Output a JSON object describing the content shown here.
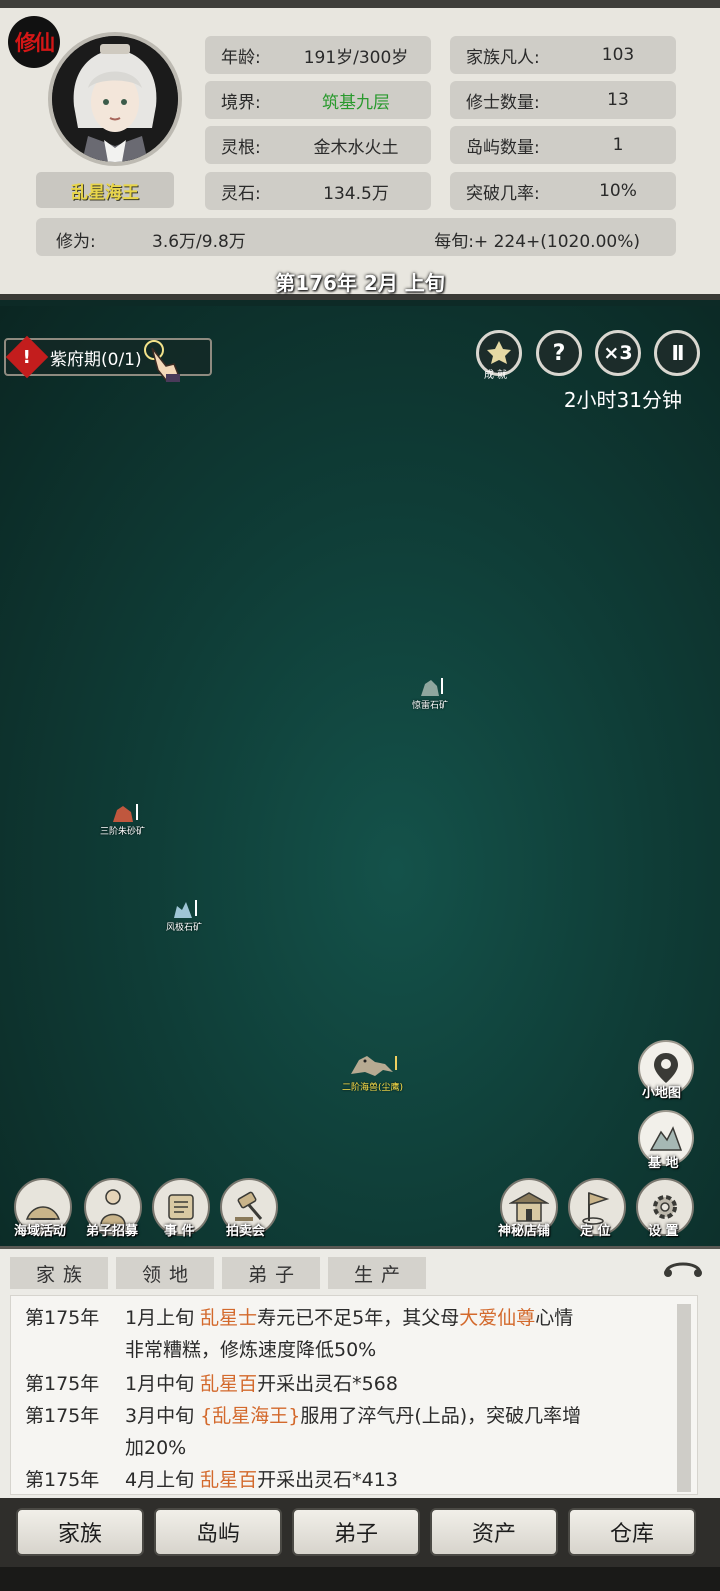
{
  "header": {
    "badge": "修仙",
    "player_name": "乱星海王",
    "stats_left": [
      {
        "label": "年龄:",
        "value": "191岁/300岁"
      },
      {
        "label": "境界:",
        "value": "筑基九层"
      },
      {
        "label": "灵根:",
        "value": "金木水火土"
      },
      {
        "label": "灵石:",
        "value": "134.5万"
      }
    ],
    "stats_right": [
      {
        "label": "家族凡人:",
        "value": "103"
      },
      {
        "label": "修士数量:",
        "value": "13"
      },
      {
        "label": "岛屿数量:",
        "value": "1"
      },
      {
        "label": "突破几率:",
        "value": "10%"
      }
    ],
    "cultivation_label": "修为:",
    "cultivation_value": "3.6万/9.8万",
    "per_period": "每旬:+ 224+(1020.00%)",
    "date": "第176年 2月 上旬"
  },
  "map": {
    "quest_label": "紫府期(0/1)",
    "quest_warn": "!",
    "buttons": {
      "achievement_label": "成 就",
      "help": "?",
      "speed": "×3",
      "pause": "II"
    },
    "timer": "2小时31分钟",
    "nodes": [
      {
        "name": "mine-1",
        "label": "惊雷石矿"
      },
      {
        "name": "mine-2",
        "label": "三阶朱砂矿"
      },
      {
        "name": "mine-3",
        "label": "风极石矿"
      },
      {
        "name": "beast",
        "label": "二阶海兽(尘鹰)"
      }
    ],
    "side": {
      "minimap": "小地图",
      "base": "基 地"
    },
    "bottom_left": [
      "海域活动",
      "弟子招募",
      "事 件",
      "拍卖会"
    ],
    "bottom_right": [
      "神秘店铺",
      "定 位",
      "设 置"
    ]
  },
  "log": {
    "tabs": [
      "家族",
      "领地",
      "弟子",
      "生产"
    ],
    "entries": [
      {
        "year": "第175年",
        "segments": [
          "1月上旬 ",
          "乱星士",
          "寿元已不足5年，其父母",
          "大爱仙尊",
          "心情"
        ],
        "line2": "非常糟糕，修炼速度降低50%"
      },
      {
        "year": "第175年",
        "segments": [
          "1月中旬 ",
          "乱星百",
          "开采出灵石*568"
        ]
      },
      {
        "year": "第175年",
        "segments": [
          "3月中旬 ",
          "{乱星海王}",
          "服用了淬气丹(上品)，突破几率增"
        ],
        "line2": "加20%"
      },
      {
        "year": "第175年",
        "segments": [
          "4月上旬 ",
          "乱星百",
          "开采出灵石*413"
        ]
      }
    ]
  },
  "nav": [
    "家族",
    "岛屿",
    "弟子",
    "资产",
    "仓库"
  ],
  "colors": {
    "realm": "#2a9a2e",
    "highlight": "#d3692c",
    "name": "#e8d54a",
    "map": "#0f3d37"
  }
}
